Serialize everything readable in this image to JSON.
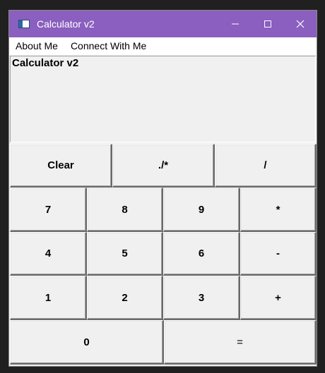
{
  "window": {
    "title": "Calculator v2",
    "accent": "#8a5fbf"
  },
  "menu": {
    "items": [
      "About Me",
      "Connect With Me"
    ]
  },
  "display": {
    "text": "Calculator v2"
  },
  "keys": {
    "clear": "Clear",
    "sqrt": "./*",
    "divide": "/",
    "seven": "7",
    "eight": "8",
    "nine": "9",
    "multiply": "*",
    "four": "4",
    "five": "5",
    "six": "6",
    "minus": "-",
    "one": "1",
    "two": "2",
    "three": "3",
    "plus": "+",
    "zero": "0",
    "equals": "="
  },
  "icons": {
    "app": "calculator-window-icon",
    "minimize": "minimize-icon",
    "maximize": "maximize-icon",
    "close": "close-icon"
  }
}
